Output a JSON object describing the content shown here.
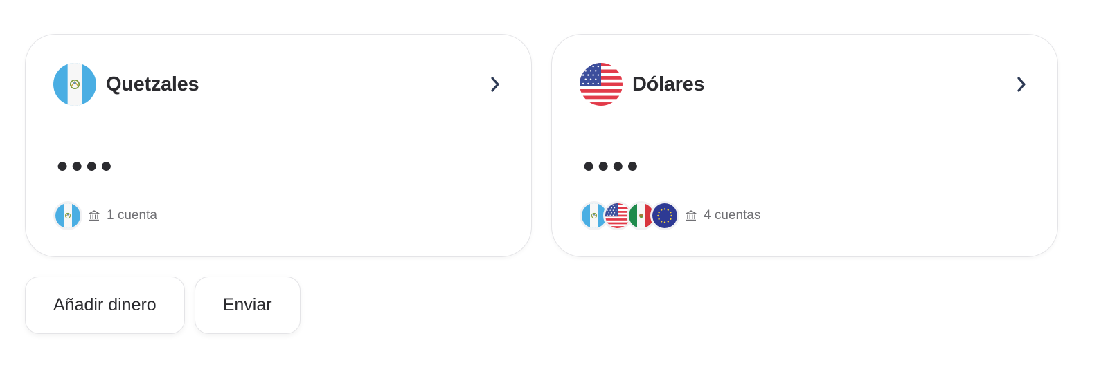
{
  "cards": [
    {
      "title": "Quetzales",
      "flag": "guatemala-flag",
      "balance_masked": "●●●●",
      "accounts_label": "1 cuenta",
      "account_flags": [
        "guatemala-flag"
      ]
    },
    {
      "title": "Dólares",
      "flag": "usa-flag",
      "balance_masked": "●●●●",
      "accounts_label": "4 cuentas",
      "account_flags": [
        "guatemala-flag",
        "usa-flag",
        "mexico-flag",
        "eu-flag"
      ]
    }
  ],
  "actions": {
    "add_money_label": "Añadir dinero",
    "send_label": "Enviar"
  },
  "icons": {
    "chevron": "chevron-right-icon",
    "bank": "bank-icon"
  },
  "colors": {
    "text": "#2b2b2f",
    "muted": "#707074",
    "border": "#e4e4e7",
    "chevron": "#2d3a55"
  }
}
